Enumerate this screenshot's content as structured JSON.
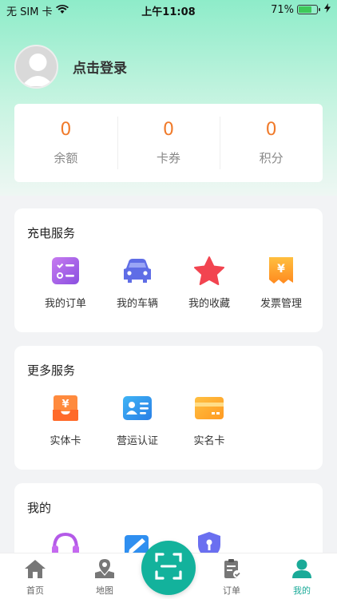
{
  "status_bar": {
    "carrier": "无 SIM 卡",
    "time": "上午11:08",
    "battery_percent_text": "71%",
    "battery_level": 0.71
  },
  "profile": {
    "login_text": "点击登录"
  },
  "stats": [
    {
      "value": "0",
      "label": "余额"
    },
    {
      "value": "0",
      "label": "卡券"
    },
    {
      "value": "0",
      "label": "积分"
    }
  ],
  "charging_services": {
    "title": "充电服务",
    "items": [
      {
        "label": "我的订单",
        "icon": "order-list-icon"
      },
      {
        "label": "我的车辆",
        "icon": "car-icon"
      },
      {
        "label": "我的收藏",
        "icon": "star-icon"
      },
      {
        "label": "发票管理",
        "icon": "invoice-icon"
      }
    ]
  },
  "more_services": {
    "title": "更多服务",
    "items": [
      {
        "label": "实体卡",
        "icon": "physical-card-icon"
      },
      {
        "label": "营运认证",
        "icon": "id-card-icon"
      },
      {
        "label": "实名卡",
        "icon": "real-name-card-icon"
      }
    ]
  },
  "mine": {
    "title": "我的",
    "items": [
      {
        "icon": "headset-icon"
      },
      {
        "icon": "feedback-icon"
      },
      {
        "icon": "shield-icon"
      }
    ]
  },
  "tabbar": {
    "tabs": [
      {
        "label": "首页",
        "icon": "home-icon"
      },
      {
        "label": "地图",
        "icon": "map-pin-icon"
      },
      {
        "label": "订单",
        "icon": "clipboard-icon"
      },
      {
        "label": "我的",
        "icon": "user-icon",
        "active": true
      }
    ],
    "scan_icon": "scan-icon"
  },
  "colors": {
    "accent": "#13b29c",
    "stat_value": "#f07a2a"
  }
}
